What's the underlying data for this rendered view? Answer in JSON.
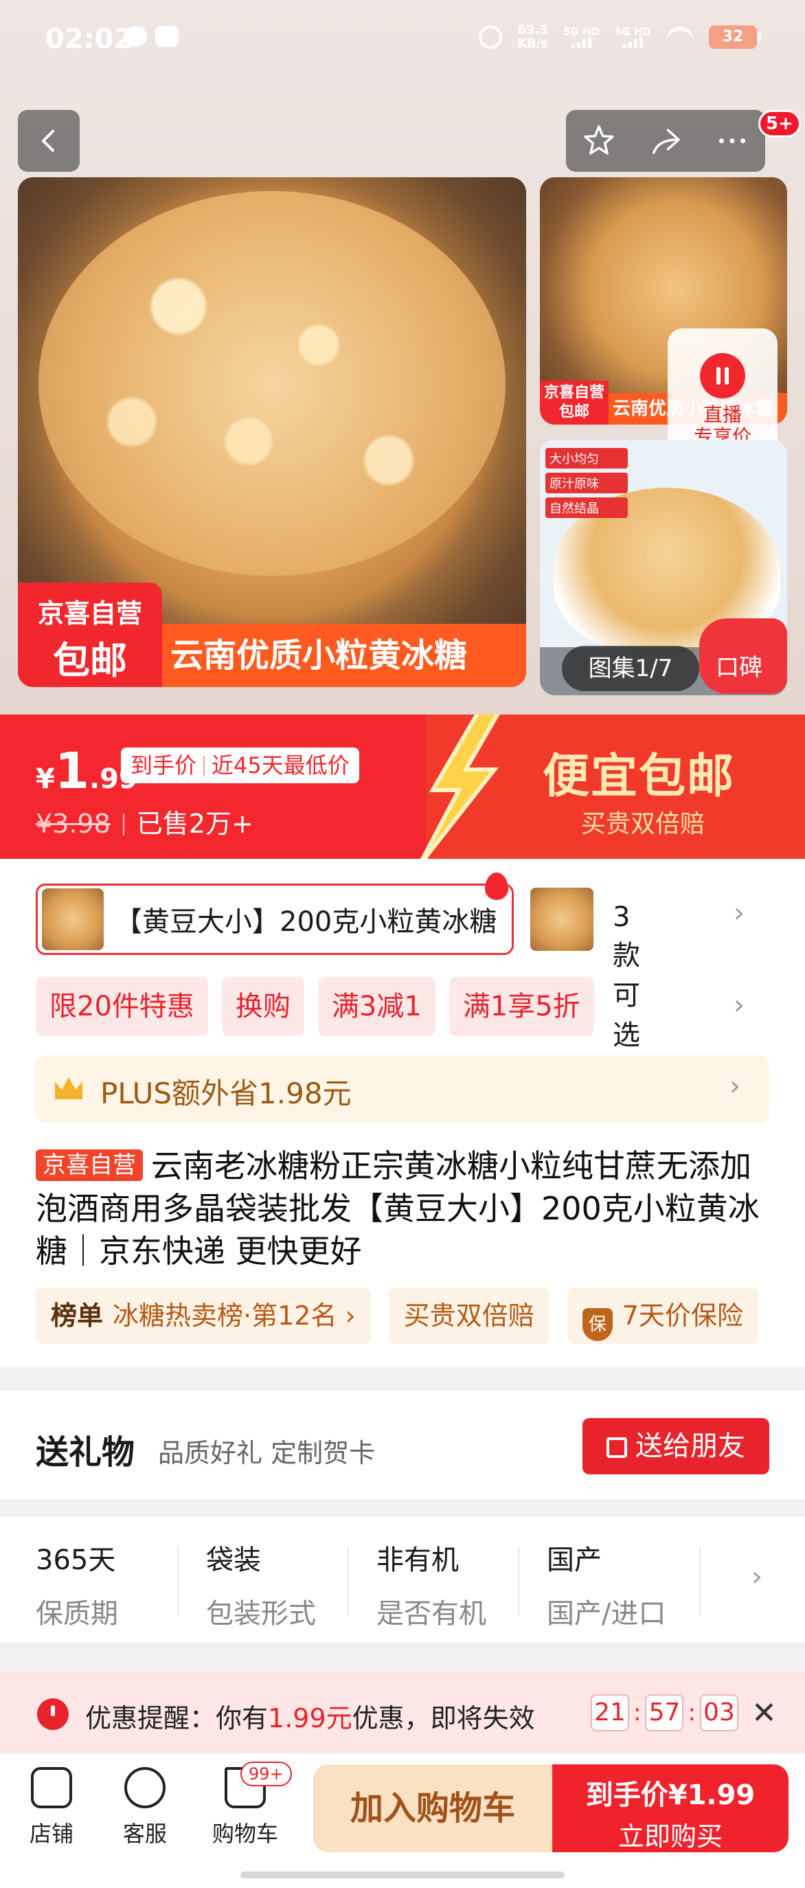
{
  "status_bar": {
    "time": "02:02",
    "net_speed_value": "69.3",
    "net_speed_unit": "KB/s",
    "sig1": "5G HD",
    "sig2": "5G HD",
    "battery": "32"
  },
  "header": {
    "cart_badge": "5+",
    "icons": [
      "back-icon",
      "star-icon",
      "share-icon",
      "more-icon"
    ]
  },
  "gallery": {
    "main_tag_line1": "京喜自营",
    "main_tag_line2": "包邮",
    "main_slogan": "云南优质小粒黄冰糖",
    "thumb_tag": "京喜自营包邮",
    "thumb_slogan": "云南优质小粒黄冰糖",
    "thumb2_chips": [
      "大小均匀",
      "原汁原味",
      "自然结晶"
    ],
    "live_line1": "直播",
    "live_line2": "专享价",
    "album": "图集1/7",
    "review": "口碑"
  },
  "price": {
    "yen": "¥",
    "int": "1",
    "dec": ".99",
    "tag_a": "到手价",
    "tag_b": "近45天最低价",
    "old_price": "¥3.98",
    "sold": "已售2万+",
    "promo_big": "便宜包邮",
    "promo_small": "买贵双倍赔"
  },
  "sku": {
    "selected": "【黄豆大小】200克小粒黄冰糖",
    "more": "3款可选"
  },
  "promo_tags": [
    "限20件特惠",
    "换购",
    "满3减1",
    "满1享5折"
  ],
  "plus": {
    "text_a": "PLUS额外省",
    "amount": "1.98元"
  },
  "product": {
    "badge": "京喜自营",
    "title": "云南老冰糖粉正宗黄冰糖小粒纯甘蔗无添加泡酒商用多晶袋装批发【黄豆大小】200克小粒黄冰糖｜京东快递 更快更好"
  },
  "rank": {
    "label": "榜单",
    "value": "冰糖热卖榜·第12名",
    "guarantee": "买贵双倍赔",
    "shield": "保",
    "price_protect": "7天价保险"
  },
  "gift": {
    "title": "送礼物",
    "subtitle": "品质好礼 定制贺卡",
    "button": "送给朋友"
  },
  "specs": [
    {
      "value": "365天",
      "key": "保质期"
    },
    {
      "value": "袋装",
      "key": "包装形式"
    },
    {
      "value": "非有机",
      "key": "是否有机"
    },
    {
      "value": "国产",
      "key": "国产/进口"
    }
  ],
  "reminder": {
    "prefix": "优惠提醒：你有",
    "amount": "1.99元",
    "suffix": "优惠，即将失效",
    "hh": "21",
    "mm": "57",
    "ss": "03"
  },
  "bottom": {
    "store": "店铺",
    "service": "客服",
    "cart": "购物车",
    "cart_badge": "99+",
    "add_cart": "加入购物车",
    "buy_line1": "到手价¥1.99",
    "buy_line2": "立即购买"
  }
}
